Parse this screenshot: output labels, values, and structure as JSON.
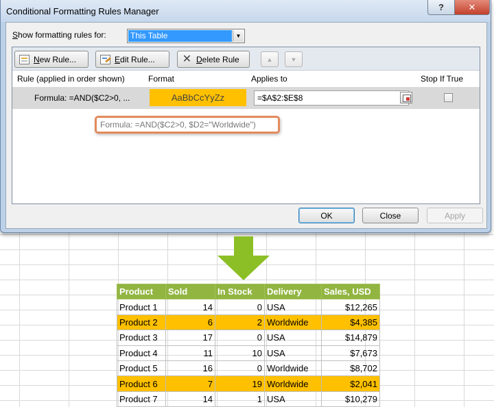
{
  "dialog": {
    "title": "Conditional Formatting Rules Manager",
    "help_glyph": "?",
    "close_glyph": "✕",
    "show_label_prefix": "S",
    "show_label_rest": "how formatting rules for:",
    "show_for_value": "This Table",
    "toolbar": {
      "new_rule_u": "N",
      "new_rule_rest": "ew Rule...",
      "edit_rule_u": "E",
      "edit_rule_rest": "dit Rule...",
      "delete_rule_u": "D",
      "delete_rule_rest": "elete Rule",
      "move_up_glyph": "▲",
      "move_down_glyph": "▼"
    },
    "columns": {
      "rule": "Rule (applied in order shown)",
      "format": "Format",
      "applies_to": "Applies to",
      "stop_if_true": "Stop If True"
    },
    "rule": {
      "name": "Formula: =AND($C2>0, ...",
      "format_preview": "AaBbCcYyZz",
      "applies_to": "=$A$2:$E$8",
      "stop_if_true": false
    },
    "tooltip": "Formula: =AND($C2>0, $D2=\"Worldwide\")",
    "buttons": {
      "ok": "OK",
      "close": "Close",
      "apply": "Apply"
    }
  },
  "colors": {
    "format_fill": "#ffc000",
    "table_header": "#92b542",
    "arrow": "#8cbf26",
    "tooltip_border": "#e38a5b"
  },
  "table": {
    "headers": [
      "Product",
      "Sold",
      "In Stock",
      "Delivery",
      "Sales,  USD"
    ],
    "rows": [
      {
        "product": "Product 1",
        "sold": "14",
        "in_stock": "0",
        "delivery": "USA",
        "sales": "$12,265",
        "highlighted": false
      },
      {
        "product": "Product 2",
        "sold": "6",
        "in_stock": "2",
        "delivery": "Worldwide",
        "sales": "$4,385",
        "highlighted": true
      },
      {
        "product": "Product 3",
        "sold": "17",
        "in_stock": "0",
        "delivery": "USA",
        "sales": "$14,879",
        "highlighted": false
      },
      {
        "product": "Product 4",
        "sold": "11",
        "in_stock": "10",
        "delivery": "USA",
        "sales": "$7,673",
        "highlighted": false
      },
      {
        "product": "Product 5",
        "sold": "16",
        "in_stock": "0",
        "delivery": "Worldwide",
        "sales": "$8,702",
        "highlighted": false
      },
      {
        "product": "Product 6",
        "sold": "7",
        "in_stock": "19",
        "delivery": "Worldwide",
        "sales": "$2,041",
        "highlighted": true
      },
      {
        "product": "Product 7",
        "sold": "14",
        "in_stock": "1",
        "delivery": "USA",
        "sales": "$10,279",
        "highlighted": false
      }
    ]
  }
}
